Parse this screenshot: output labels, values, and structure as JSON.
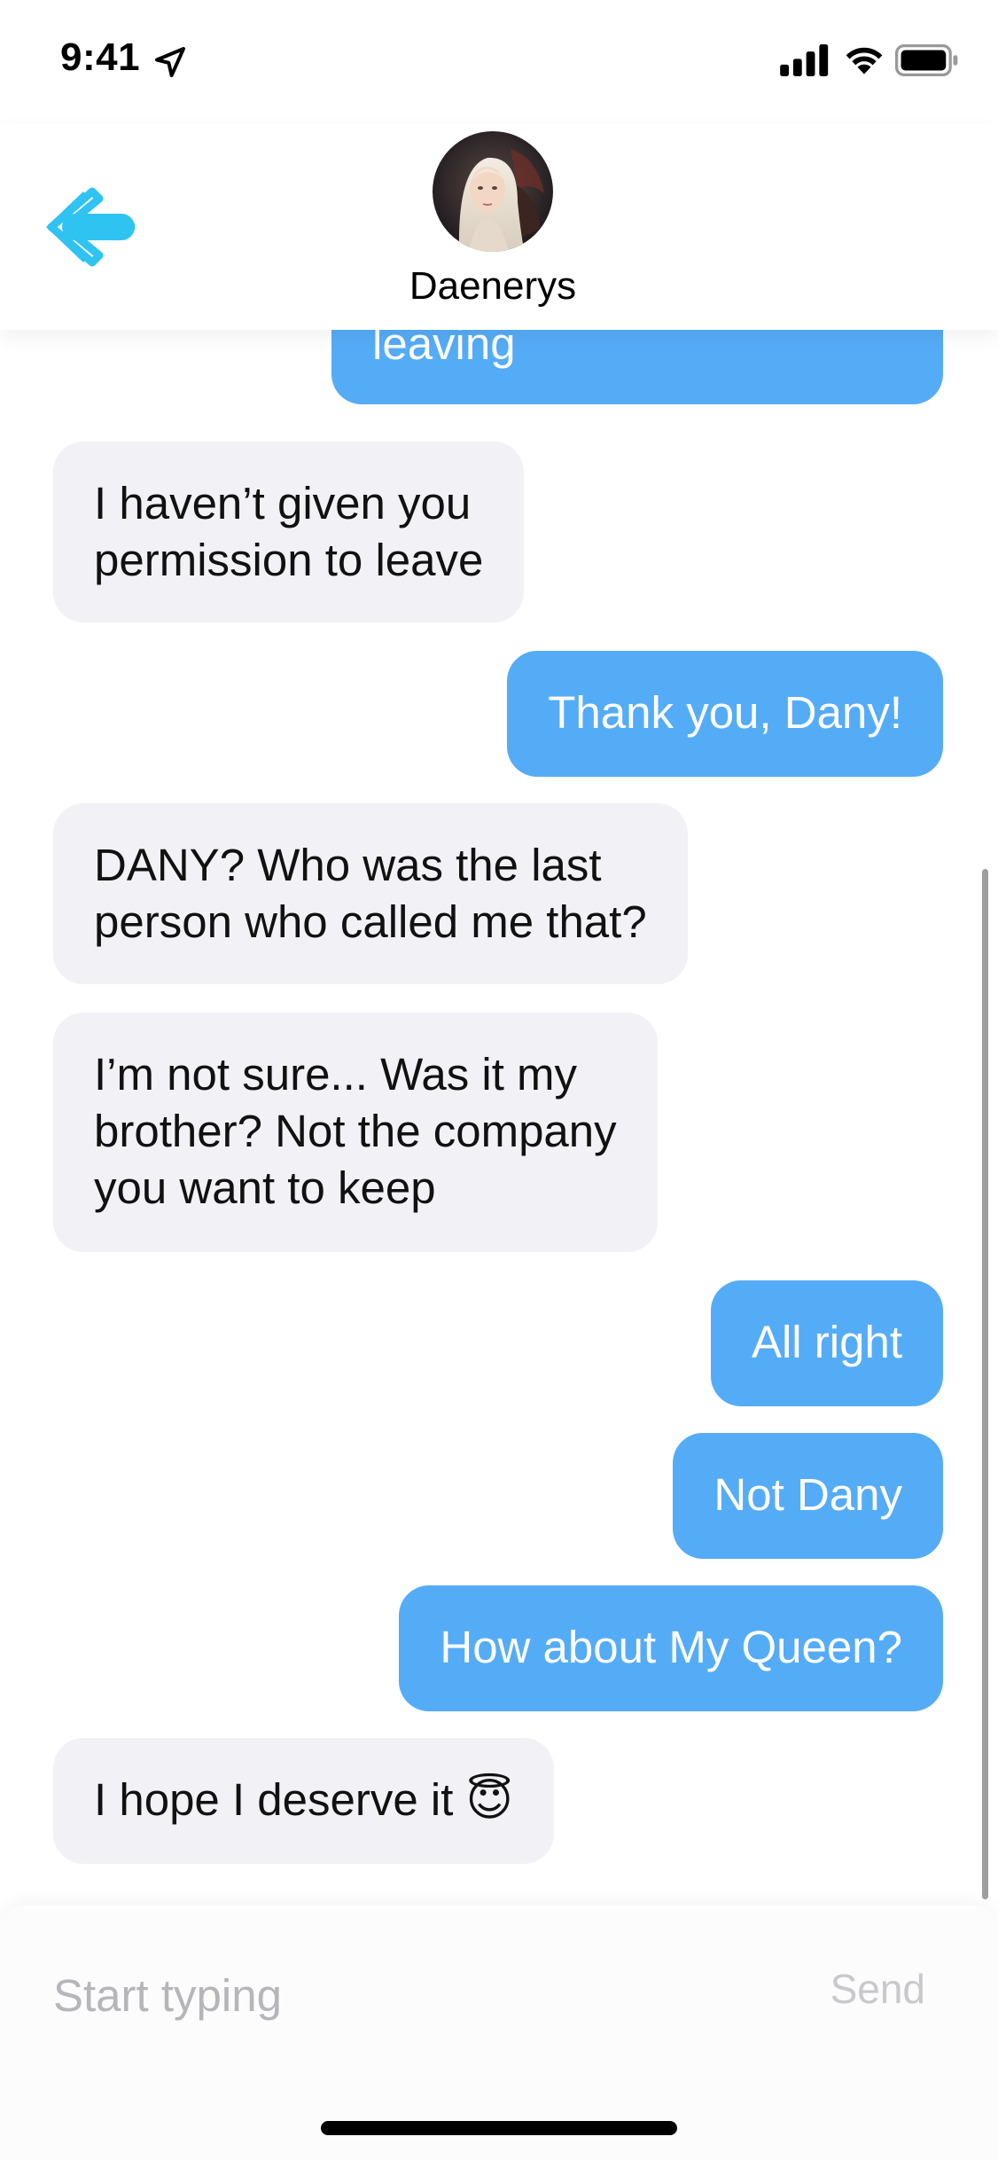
{
  "status_bar": {
    "time": "9:41",
    "location_icon": "location-arrow-icon",
    "signal_icon": "cellular-signal-icon",
    "wifi_icon": "wifi-icon",
    "battery_icon": "battery-icon"
  },
  "header": {
    "back_icon": "back-arrow-icon",
    "contact_name": "Daenerys",
    "accent_color": "#2fc3f2"
  },
  "messages": [
    {
      "side": "outgoing",
      "text": "leaving"
    },
    {
      "side": "incoming",
      "text": "I haven’t given you\npermission to leave"
    },
    {
      "side": "outgoing",
      "text": "Thank you, Dany!"
    },
    {
      "side": "incoming",
      "text": "DANY? Who was the last\nperson who called me that?"
    },
    {
      "side": "incoming",
      "text": "I’m not sure... Was it my\nbrother? Not the company\nyou want to keep"
    },
    {
      "side": "outgoing",
      "text": "All right"
    },
    {
      "side": "outgoing",
      "text": "Not Dany"
    },
    {
      "side": "outgoing",
      "text": "How about My Queen?"
    },
    {
      "side": "incoming",
      "text": "I hope I deserve it 😇"
    }
  ],
  "colors": {
    "outgoing_bubble": "#55acf6",
    "incoming_bubble": "#f2f2f6"
  },
  "composer": {
    "placeholder": "Start typing",
    "value": "",
    "send_label": "Send"
  }
}
